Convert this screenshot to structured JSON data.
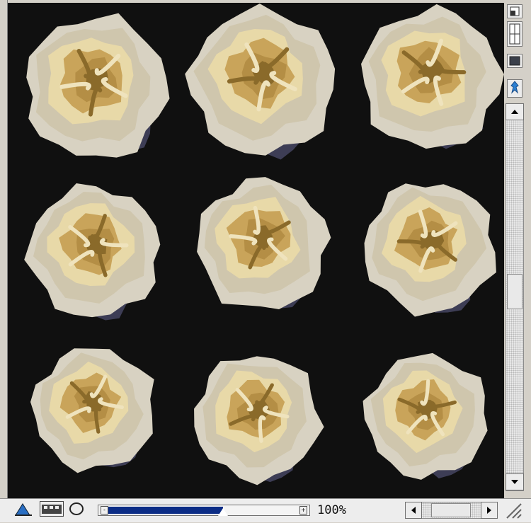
{
  "canvas": {
    "background": "#101010",
    "content": "rose-grid"
  },
  "status_bar": {
    "zoom_label": "100%",
    "zoom_level_fraction": 0.6
  },
  "palette": {
    "icons": [
      "layers-icon",
      "grid-icon",
      "swatch-icon",
      "pin-icon"
    ]
  },
  "colors": {
    "rose_dark": "#8a6a2a",
    "rose_mid": "#c9a45a",
    "rose_light": "#e8d9a8",
    "rose_pale": "#d8d2c2",
    "rose_shadow": "#3d3d55",
    "zoom_fill": "#0c2d86"
  }
}
